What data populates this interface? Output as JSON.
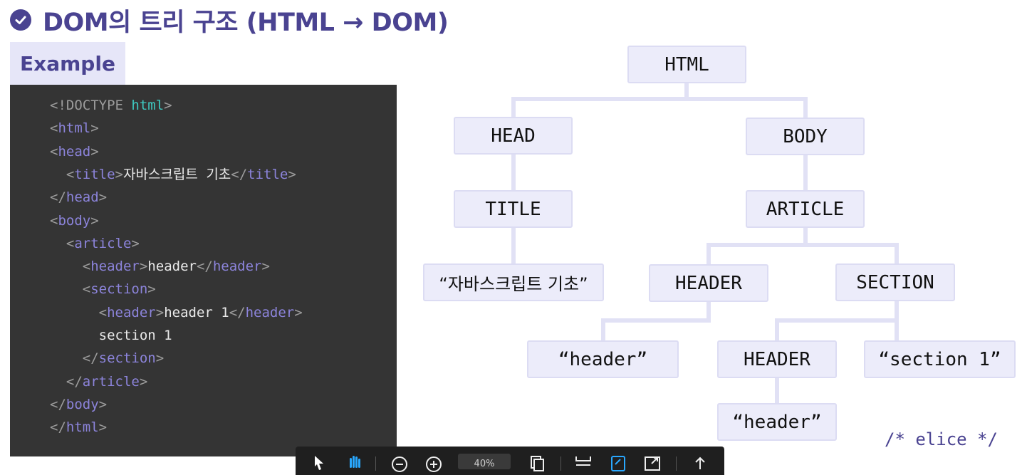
{
  "slide": {
    "title": "DOM의 트리 구조 (HTML → DOM)",
    "example_tab": "Example",
    "watermark": "/* elice */",
    "accent_color": "#4a4391"
  },
  "code": {
    "lines": [
      [
        {
          "c": "p",
          "t": "<!DOCTYPE "
        },
        {
          "c": "k",
          "t": "html"
        },
        {
          "c": "p",
          "t": ">"
        }
      ],
      [
        {
          "c": "p",
          "t": "<"
        },
        {
          "c": "t",
          "t": "html"
        },
        {
          "c": "p",
          "t": ">"
        }
      ],
      [
        {
          "c": "p",
          "t": "<"
        },
        {
          "c": "t",
          "t": "head"
        },
        {
          "c": "p",
          "t": ">"
        }
      ],
      [
        {
          "c": "s",
          "t": "  "
        },
        {
          "c": "p",
          "t": "<"
        },
        {
          "c": "t",
          "t": "title"
        },
        {
          "c": "p",
          "t": ">"
        },
        {
          "c": "s",
          "t": "자바스크립트 기초"
        },
        {
          "c": "p",
          "t": "</"
        },
        {
          "c": "t",
          "t": "title"
        },
        {
          "c": "p",
          "t": ">"
        }
      ],
      [
        {
          "c": "p",
          "t": "</"
        },
        {
          "c": "t",
          "t": "head"
        },
        {
          "c": "p",
          "t": ">"
        }
      ],
      [
        {
          "c": "p",
          "t": "<"
        },
        {
          "c": "t",
          "t": "body"
        },
        {
          "c": "p",
          "t": ">"
        }
      ],
      [
        {
          "c": "s",
          "t": "  "
        },
        {
          "c": "p",
          "t": "<"
        },
        {
          "c": "t",
          "t": "article"
        },
        {
          "c": "p",
          "t": ">"
        }
      ],
      [
        {
          "c": "s",
          "t": "    "
        },
        {
          "c": "p",
          "t": "<"
        },
        {
          "c": "t",
          "t": "header"
        },
        {
          "c": "p",
          "t": ">"
        },
        {
          "c": "s",
          "t": "header"
        },
        {
          "c": "p",
          "t": "</"
        },
        {
          "c": "t",
          "t": "header"
        },
        {
          "c": "p",
          "t": ">"
        }
      ],
      [
        {
          "c": "s",
          "t": "    "
        },
        {
          "c": "p",
          "t": "<"
        },
        {
          "c": "t",
          "t": "section"
        },
        {
          "c": "p",
          "t": ">"
        }
      ],
      [
        {
          "c": "s",
          "t": "      "
        },
        {
          "c": "p",
          "t": "<"
        },
        {
          "c": "t",
          "t": "header"
        },
        {
          "c": "p",
          "t": ">"
        },
        {
          "c": "s",
          "t": "header 1"
        },
        {
          "c": "p",
          "t": "</"
        },
        {
          "c": "t",
          "t": "header"
        },
        {
          "c": "p",
          "t": ">"
        }
      ],
      [
        {
          "c": "s",
          "t": "      section 1"
        }
      ],
      [
        {
          "c": "s",
          "t": "    "
        },
        {
          "c": "p",
          "t": "</"
        },
        {
          "c": "t",
          "t": "section"
        },
        {
          "c": "p",
          "t": ">"
        }
      ],
      [
        {
          "c": "s",
          "t": "  "
        },
        {
          "c": "p",
          "t": "</"
        },
        {
          "c": "t",
          "t": "article"
        },
        {
          "c": "p",
          "t": ">"
        }
      ],
      [
        {
          "c": "p",
          "t": "</"
        },
        {
          "c": "t",
          "t": "body"
        },
        {
          "c": "p",
          "t": ">"
        }
      ],
      [
        {
          "c": "p",
          "t": "</"
        },
        {
          "c": "t",
          "t": "html"
        },
        {
          "c": "p",
          "t": ">"
        }
      ]
    ]
  },
  "tree": {
    "html": "HTML",
    "head": "HEAD",
    "body": "BODY",
    "title": "TITLE",
    "article": "ARTICLE",
    "title_text": "“자바스크립트 기초”",
    "header": "HEADER",
    "section": "SECTION",
    "header_text": "“header”",
    "section_header": "HEADER",
    "section_text": "“section 1”",
    "section_header_text": "“header”"
  },
  "toolbar": {
    "zoom": "40%",
    "icons": [
      "pointer-icon",
      "hand-icon",
      "zoom-out-icon",
      "zoom-in-icon",
      "copy-icon",
      "fit-page-icon",
      "edit-icon",
      "fullscreen-icon",
      "upload-icon"
    ]
  }
}
